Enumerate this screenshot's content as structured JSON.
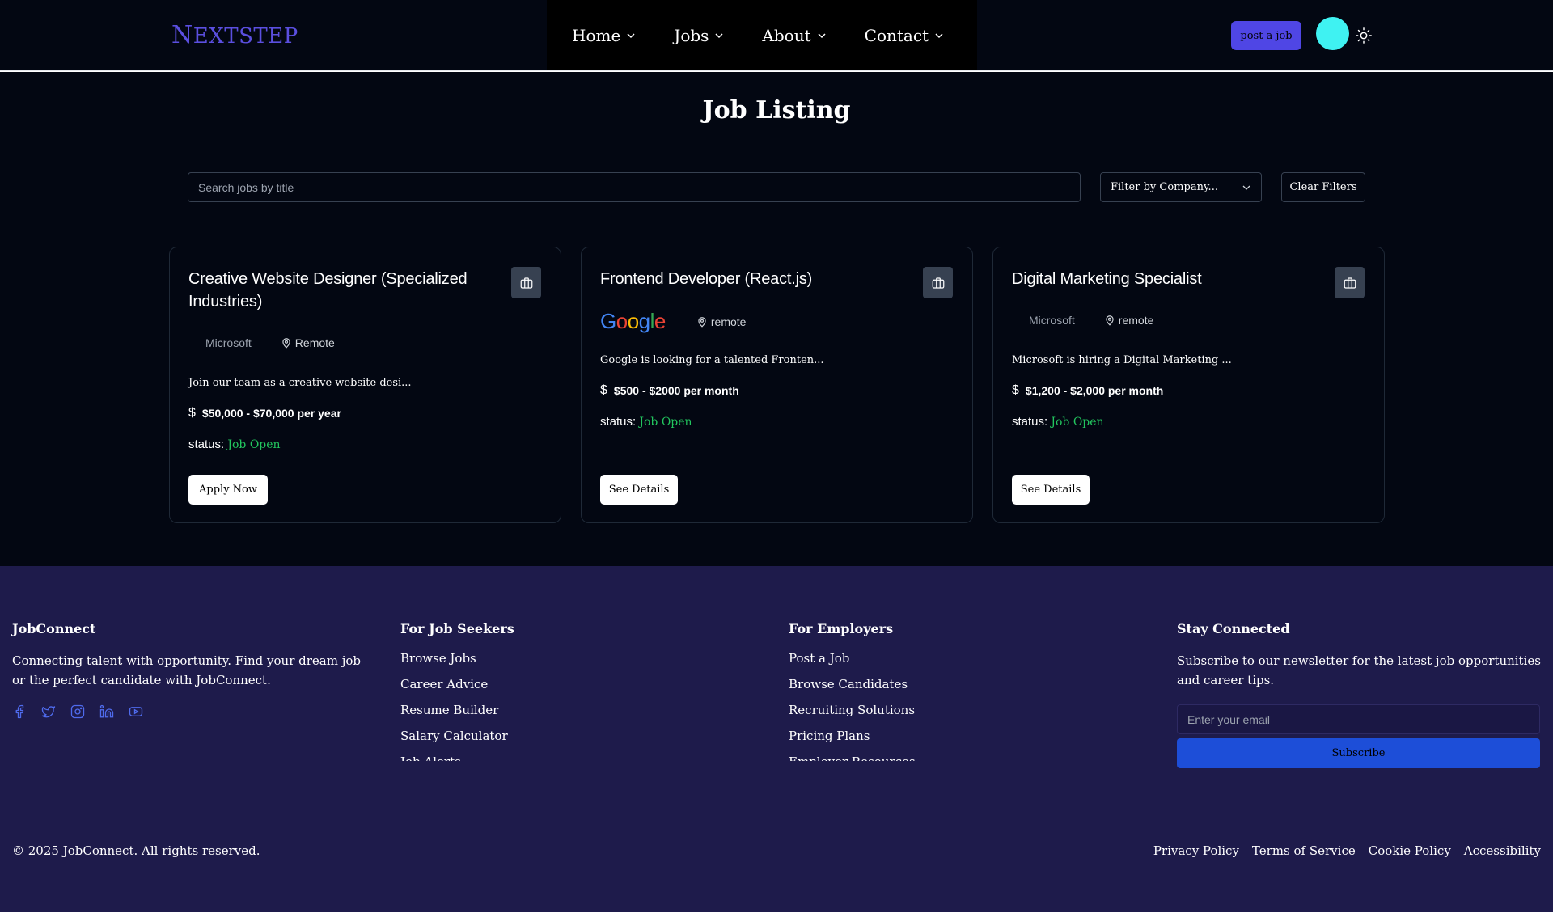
{
  "header": {
    "logo_first": "N",
    "logo_rest": "EXTSTEP",
    "nav": [
      {
        "label": "Home"
      },
      {
        "label": "Jobs"
      },
      {
        "label": "About"
      },
      {
        "label": "Contact"
      }
    ],
    "post_job_label": "post a job",
    "avatar_color": "#3ff2f2",
    "accent": "#4f46e5"
  },
  "main": {
    "title": "Job Listing",
    "search_placeholder": "Search jobs by title",
    "filter_label": "Filter by Company...",
    "clear_label": "Clear Filters"
  },
  "jobs": [
    {
      "title": "Creative Website Designer (Specialized Industries)",
      "company": "Microsoft",
      "location": "Remote",
      "description": "Join our team as a creative website desi...",
      "salary_symbol": "$",
      "salary": "$50,000 - $70,000 per year",
      "status_label": "status:",
      "status_value": "Job Open",
      "button": "Apply Now",
      "icon": "briefcase-icon"
    },
    {
      "title": "Frontend Developer (React.js)",
      "company_logo": "google-logo",
      "location": "remote",
      "description": "Google is looking for a talented Fronten...",
      "salary_symbol": "$",
      "salary": "$500 - $2000 per month",
      "status_label": "status:",
      "status_value": "Job Open",
      "button": "See Details",
      "icon": "briefcase-icon"
    },
    {
      "title": "Digital Marketing Specialist",
      "company": "Microsoft",
      "location": "remote",
      "description": "Microsoft is hiring a Digital Marketing ...",
      "salary_symbol": "$",
      "salary": "$1,200 - $2,000 per month",
      "status_label": "status:",
      "status_value": "Job Open",
      "button": "See Details",
      "icon": "briefcase-icon"
    }
  ],
  "footer": {
    "brand": {
      "title": "JobConnect",
      "text": "Connecting talent with opportunity. Find your dream job or the perfect candidate with JobConnect.",
      "social": [
        "facebook-icon",
        "twitter-icon",
        "instagram-icon",
        "linkedin-icon",
        "youtube-icon"
      ]
    },
    "seekers": {
      "title": "For Job Seekers",
      "links": [
        "Browse Jobs",
        "Career Advice",
        "Resume Builder",
        "Salary Calculator",
        "Job Alerts"
      ]
    },
    "employers": {
      "title": "For Employers",
      "links": [
        "Post a Job",
        "Browse Candidates",
        "Recruiting Solutions",
        "Pricing Plans",
        "Employer Resources"
      ]
    },
    "newsletter": {
      "title": "Stay Connected",
      "text": "Subscribe to our newsletter for the latest job opportunities and career tips.",
      "email_placeholder": "Enter your email",
      "subscribe_label": "Subscribe"
    },
    "copyright": "© 2025 JobConnect. All rights reserved.",
    "legal": [
      "Privacy Policy",
      "Terms of Service",
      "Cookie Policy",
      "Accessibility"
    ]
  }
}
